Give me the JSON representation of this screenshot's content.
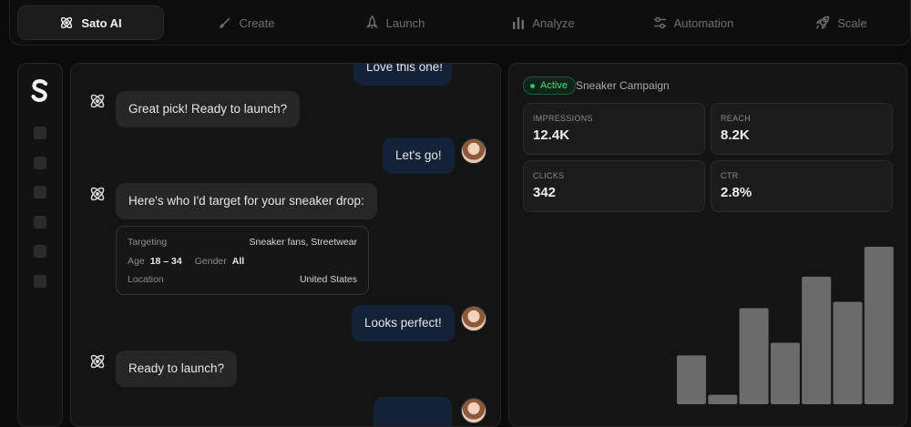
{
  "nav": {
    "tabs": [
      {
        "label": "Sato AI",
        "icon": "atom-icon"
      },
      {
        "label": "Create",
        "icon": "brush-icon"
      },
      {
        "label": "Launch",
        "icon": "rocket-icon"
      },
      {
        "label": "Analyze",
        "icon": "bar-chart-icon"
      },
      {
        "label": "Automation",
        "icon": "sliders-icon"
      },
      {
        "label": "Scale",
        "icon": "rocket-launch-icon"
      }
    ],
    "active_tab": "Sato AI"
  },
  "chat": {
    "messages": [
      {
        "from": "user",
        "text": "Love this one!"
      },
      {
        "from": "bot",
        "text": "Great pick! Ready to launch?"
      },
      {
        "from": "user",
        "text": "Let's go!"
      },
      {
        "from": "bot",
        "text": "Here's who I'd target for your sneaker drop:"
      },
      {
        "from": "user",
        "text": "Looks perfect!"
      },
      {
        "from": "bot",
        "text": "Ready to launch?"
      }
    ],
    "targeting": {
      "targeting_label": "Targeting",
      "targeting_value": "Sneaker fans, Streetwear",
      "age_label": "Age",
      "age_value": "18 – 34",
      "gender_label": "Gender",
      "gender_value": "All",
      "location_label": "Location",
      "location_value": "United States"
    }
  },
  "campaign": {
    "status": "Active",
    "name": "Sneaker Campaign",
    "stats": [
      {
        "label": "IMPRESSIONS",
        "value": "12.4K"
      },
      {
        "label": "REACH",
        "value": "8.2K"
      },
      {
        "label": "CLICKS",
        "value": "342"
      },
      {
        "label": "CTR",
        "value": "2.8%"
      }
    ]
  },
  "colors": {
    "background": "#0b0b0b",
    "panel": "#141414",
    "user_bubble": "#132236",
    "bot_bubble": "#262626",
    "active_green": "#22c55e",
    "bar": "#6b6b6b"
  },
  "chart_data": {
    "type": "bar",
    "categories": [],
    "values": [
      0.31,
      0.06,
      0.61,
      0.39,
      0.81,
      0.65,
      1.0
    ],
    "title": "",
    "xlabel": "",
    "ylabel": ""
  }
}
